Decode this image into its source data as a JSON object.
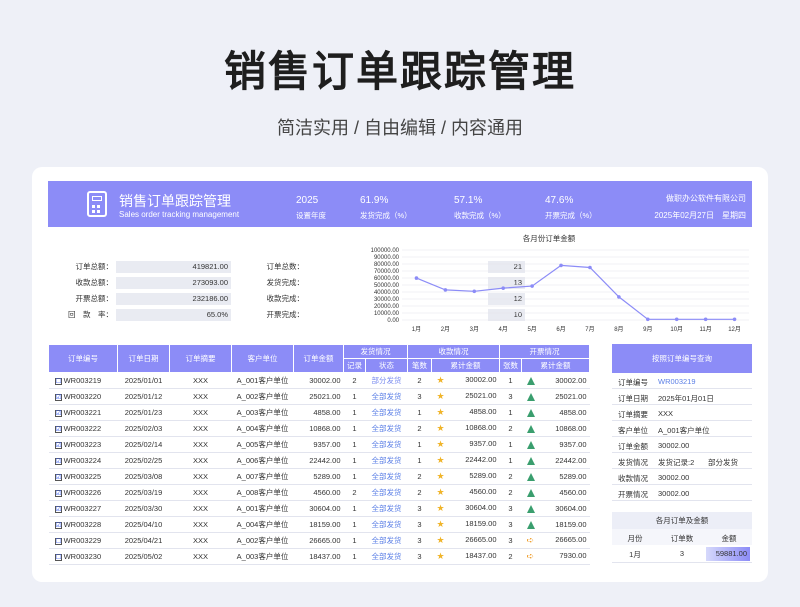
{
  "page": {
    "title": "销售订单跟踪管理",
    "subtitle": "简洁实用 / 自由编辑 / 内容通用"
  },
  "header": {
    "title": "销售订单跟踪管理",
    "subtitle": "Sales order tracking management",
    "stats": [
      {
        "value": "2025",
        "label": "设置年度"
      },
      {
        "value": "61.9%",
        "label": "发货完成（%）"
      },
      {
        "value": "57.1%",
        "label": "收款完成（%）"
      },
      {
        "value": "47.6%",
        "label": "开票完成（%）"
      }
    ],
    "company": "做职办公软件有限公司",
    "date": "2025年02月27日　星期四"
  },
  "summary_left": [
    {
      "label": "订单总额：",
      "value": "419821.00"
    },
    {
      "label": "收款总额：",
      "value": "273093.00"
    },
    {
      "label": "开票总额：",
      "value": "232186.00"
    },
    {
      "label": "回　款　率：",
      "value": "65.0%"
    }
  ],
  "summary_right": [
    {
      "label": "订单总数：",
      "value": "21"
    },
    {
      "label": "发货完成：",
      "value": "13"
    },
    {
      "label": "收款完成：",
      "value": "12"
    },
    {
      "label": "开票完成：",
      "value": "10"
    }
  ],
  "chart_data": {
    "type": "line",
    "title": "各月份订单金额",
    "categories": [
      "1月",
      "2月",
      "3月",
      "4月",
      "5月",
      "6月",
      "7月",
      "8月",
      "9月",
      "10月",
      "11月",
      "12月"
    ],
    "values": [
      59881,
      43000,
      41000,
      45500,
      48500,
      78000,
      75000,
      33000,
      1000,
      1000,
      1000,
      1000
    ],
    "ylim": [
      0,
      100000
    ],
    "yticks": [
      "0.00",
      "10000.00",
      "20000.00",
      "30000.00",
      "40000.00",
      "50000.00",
      "60000.00",
      "70000.00",
      "80000.00",
      "90000.00",
      "100000.00"
    ],
    "color": "#8c8cf7"
  },
  "table": {
    "headers": {
      "order_no": "订单编号",
      "order_date": "订单日期",
      "summary": "订单摘要",
      "customer": "客户单位",
      "amount": "订单金额",
      "ship": "发货情况",
      "ship_record": "记录",
      "ship_status": "状态",
      "pay": "收款情况",
      "pay_count": "笔数",
      "pay_total": "累计金额",
      "invoice": "开票情况",
      "inv_count": "张数",
      "inv_total": "累计金额"
    },
    "rows": [
      {
        "check": "☐",
        "no": "WR003219",
        "date": "2025/01/01",
        "sum": "XXX",
        "cust": "A_001客户单位",
        "amt": "30002.00",
        "rec": "2",
        "status": "部分发货",
        "pc": "2",
        "pt": "30002.00",
        "ic": "1",
        "it": "30002.00",
        "st": "part",
        "inv_icon": "tree"
      },
      {
        "check": "☑",
        "no": "WR003220",
        "date": "2025/01/12",
        "sum": "XXX",
        "cust": "A_002客户单位",
        "amt": "25021.00",
        "rec": "1",
        "status": "全部发货",
        "pc": "3",
        "pt": "25021.00",
        "ic": "3",
        "it": "25021.00",
        "st": "done",
        "inv_icon": "tree"
      },
      {
        "check": "☑",
        "no": "WR003221",
        "date": "2025/01/23",
        "sum": "XXX",
        "cust": "A_003客户单位",
        "amt": "4858.00",
        "rec": "1",
        "status": "全部发货",
        "pc": "1",
        "pt": "4858.00",
        "ic": "1",
        "it": "4858.00",
        "st": "done",
        "inv_icon": "tree"
      },
      {
        "check": "☑",
        "no": "WR003222",
        "date": "2025/02/03",
        "sum": "XXX",
        "cust": "A_004客户单位",
        "amt": "10868.00",
        "rec": "1",
        "status": "全部发货",
        "pc": "2",
        "pt": "10868.00",
        "ic": "2",
        "it": "10868.00",
        "st": "done",
        "inv_icon": "tree"
      },
      {
        "check": "☑",
        "no": "WR003223",
        "date": "2025/02/14",
        "sum": "XXX",
        "cust": "A_005客户单位",
        "amt": "9357.00",
        "rec": "1",
        "status": "全部发货",
        "pc": "1",
        "pt": "9357.00",
        "ic": "1",
        "it": "9357.00",
        "st": "done",
        "inv_icon": "tree"
      },
      {
        "check": "☑",
        "no": "WR003224",
        "date": "2025/02/25",
        "sum": "XXX",
        "cust": "A_006客户单位",
        "amt": "22442.00",
        "rec": "1",
        "status": "全部发货",
        "pc": "1",
        "pt": "22442.00",
        "ic": "1",
        "it": "22442.00",
        "st": "done",
        "inv_icon": "tree"
      },
      {
        "check": "☑",
        "no": "WR003225",
        "date": "2025/03/08",
        "sum": "XXX",
        "cust": "A_007客户单位",
        "amt": "5289.00",
        "rec": "1",
        "status": "全部发货",
        "pc": "2",
        "pt": "5289.00",
        "ic": "2",
        "it": "5289.00",
        "st": "done",
        "inv_icon": "tree"
      },
      {
        "check": "☑",
        "no": "WR003226",
        "date": "2025/03/19",
        "sum": "XXX",
        "cust": "A_008客户单位",
        "amt": "4560.00",
        "rec": "2",
        "status": "全部发货",
        "pc": "2",
        "pt": "4560.00",
        "ic": "2",
        "it": "4560.00",
        "st": "done",
        "inv_icon": "tree"
      },
      {
        "check": "☑",
        "no": "WR003227",
        "date": "2025/03/30",
        "sum": "XXX",
        "cust": "A_001客户单位",
        "amt": "30604.00",
        "rec": "1",
        "status": "全部发货",
        "pc": "3",
        "pt": "30604.00",
        "ic": "3",
        "it": "30604.00",
        "st": "done",
        "inv_icon": "tree"
      },
      {
        "check": "☑",
        "no": "WR003228",
        "date": "2025/04/10",
        "sum": "XXX",
        "cust": "A_004客户单位",
        "amt": "18159.00",
        "rec": "1",
        "status": "全部发货",
        "pc": "3",
        "pt": "18159.00",
        "ic": "3",
        "it": "18159.00",
        "st": "done",
        "inv_icon": "tree"
      },
      {
        "check": "☐",
        "no": "WR003229",
        "date": "2025/04/21",
        "sum": "XXX",
        "cust": "A_002客户单位",
        "amt": "26665.00",
        "rec": "1",
        "status": "全部发货",
        "pc": "3",
        "pt": "26665.00",
        "ic": "3",
        "it": "26665.00",
        "st": "done",
        "inv_icon": "arrow"
      },
      {
        "check": "☐",
        "no": "WR003230",
        "date": "2025/05/02",
        "sum": "XXX",
        "cust": "A_003客户单位",
        "amt": "18437.00",
        "rec": "1",
        "status": "全部发货",
        "pc": "3",
        "pt": "18437.00",
        "ic": "2",
        "it": "7930.00",
        "st": "done",
        "inv_icon": "arrow"
      }
    ]
  },
  "query": {
    "title": "按照订单编号查询",
    "rows": [
      {
        "label": "订单编号",
        "value": "WR003219",
        "extra": ""
      },
      {
        "label": "订单日期",
        "value": "2025年01月01日",
        "extra": ""
      },
      {
        "label": "订单摘要",
        "value": "XXX",
        "extra": ""
      },
      {
        "label": "客户单位",
        "value": "A_001客户单位",
        "extra": ""
      },
      {
        "label": "订单金额",
        "value": "30002.00",
        "extra": ""
      },
      {
        "label": "发货情况",
        "value": "发货记录:2",
        "extra": "部分发货"
      },
      {
        "label": "收款情况",
        "value": "30002.00",
        "extra": ""
      },
      {
        "label": "开票情况",
        "value": "30002.00",
        "extra": ""
      }
    ]
  },
  "monthly": {
    "title": "各月订单及金额",
    "col_month": "月份",
    "col_count": "订单数",
    "col_amount": "金额",
    "row": {
      "month": "1月",
      "count": "3",
      "amount": "59881.00"
    }
  }
}
